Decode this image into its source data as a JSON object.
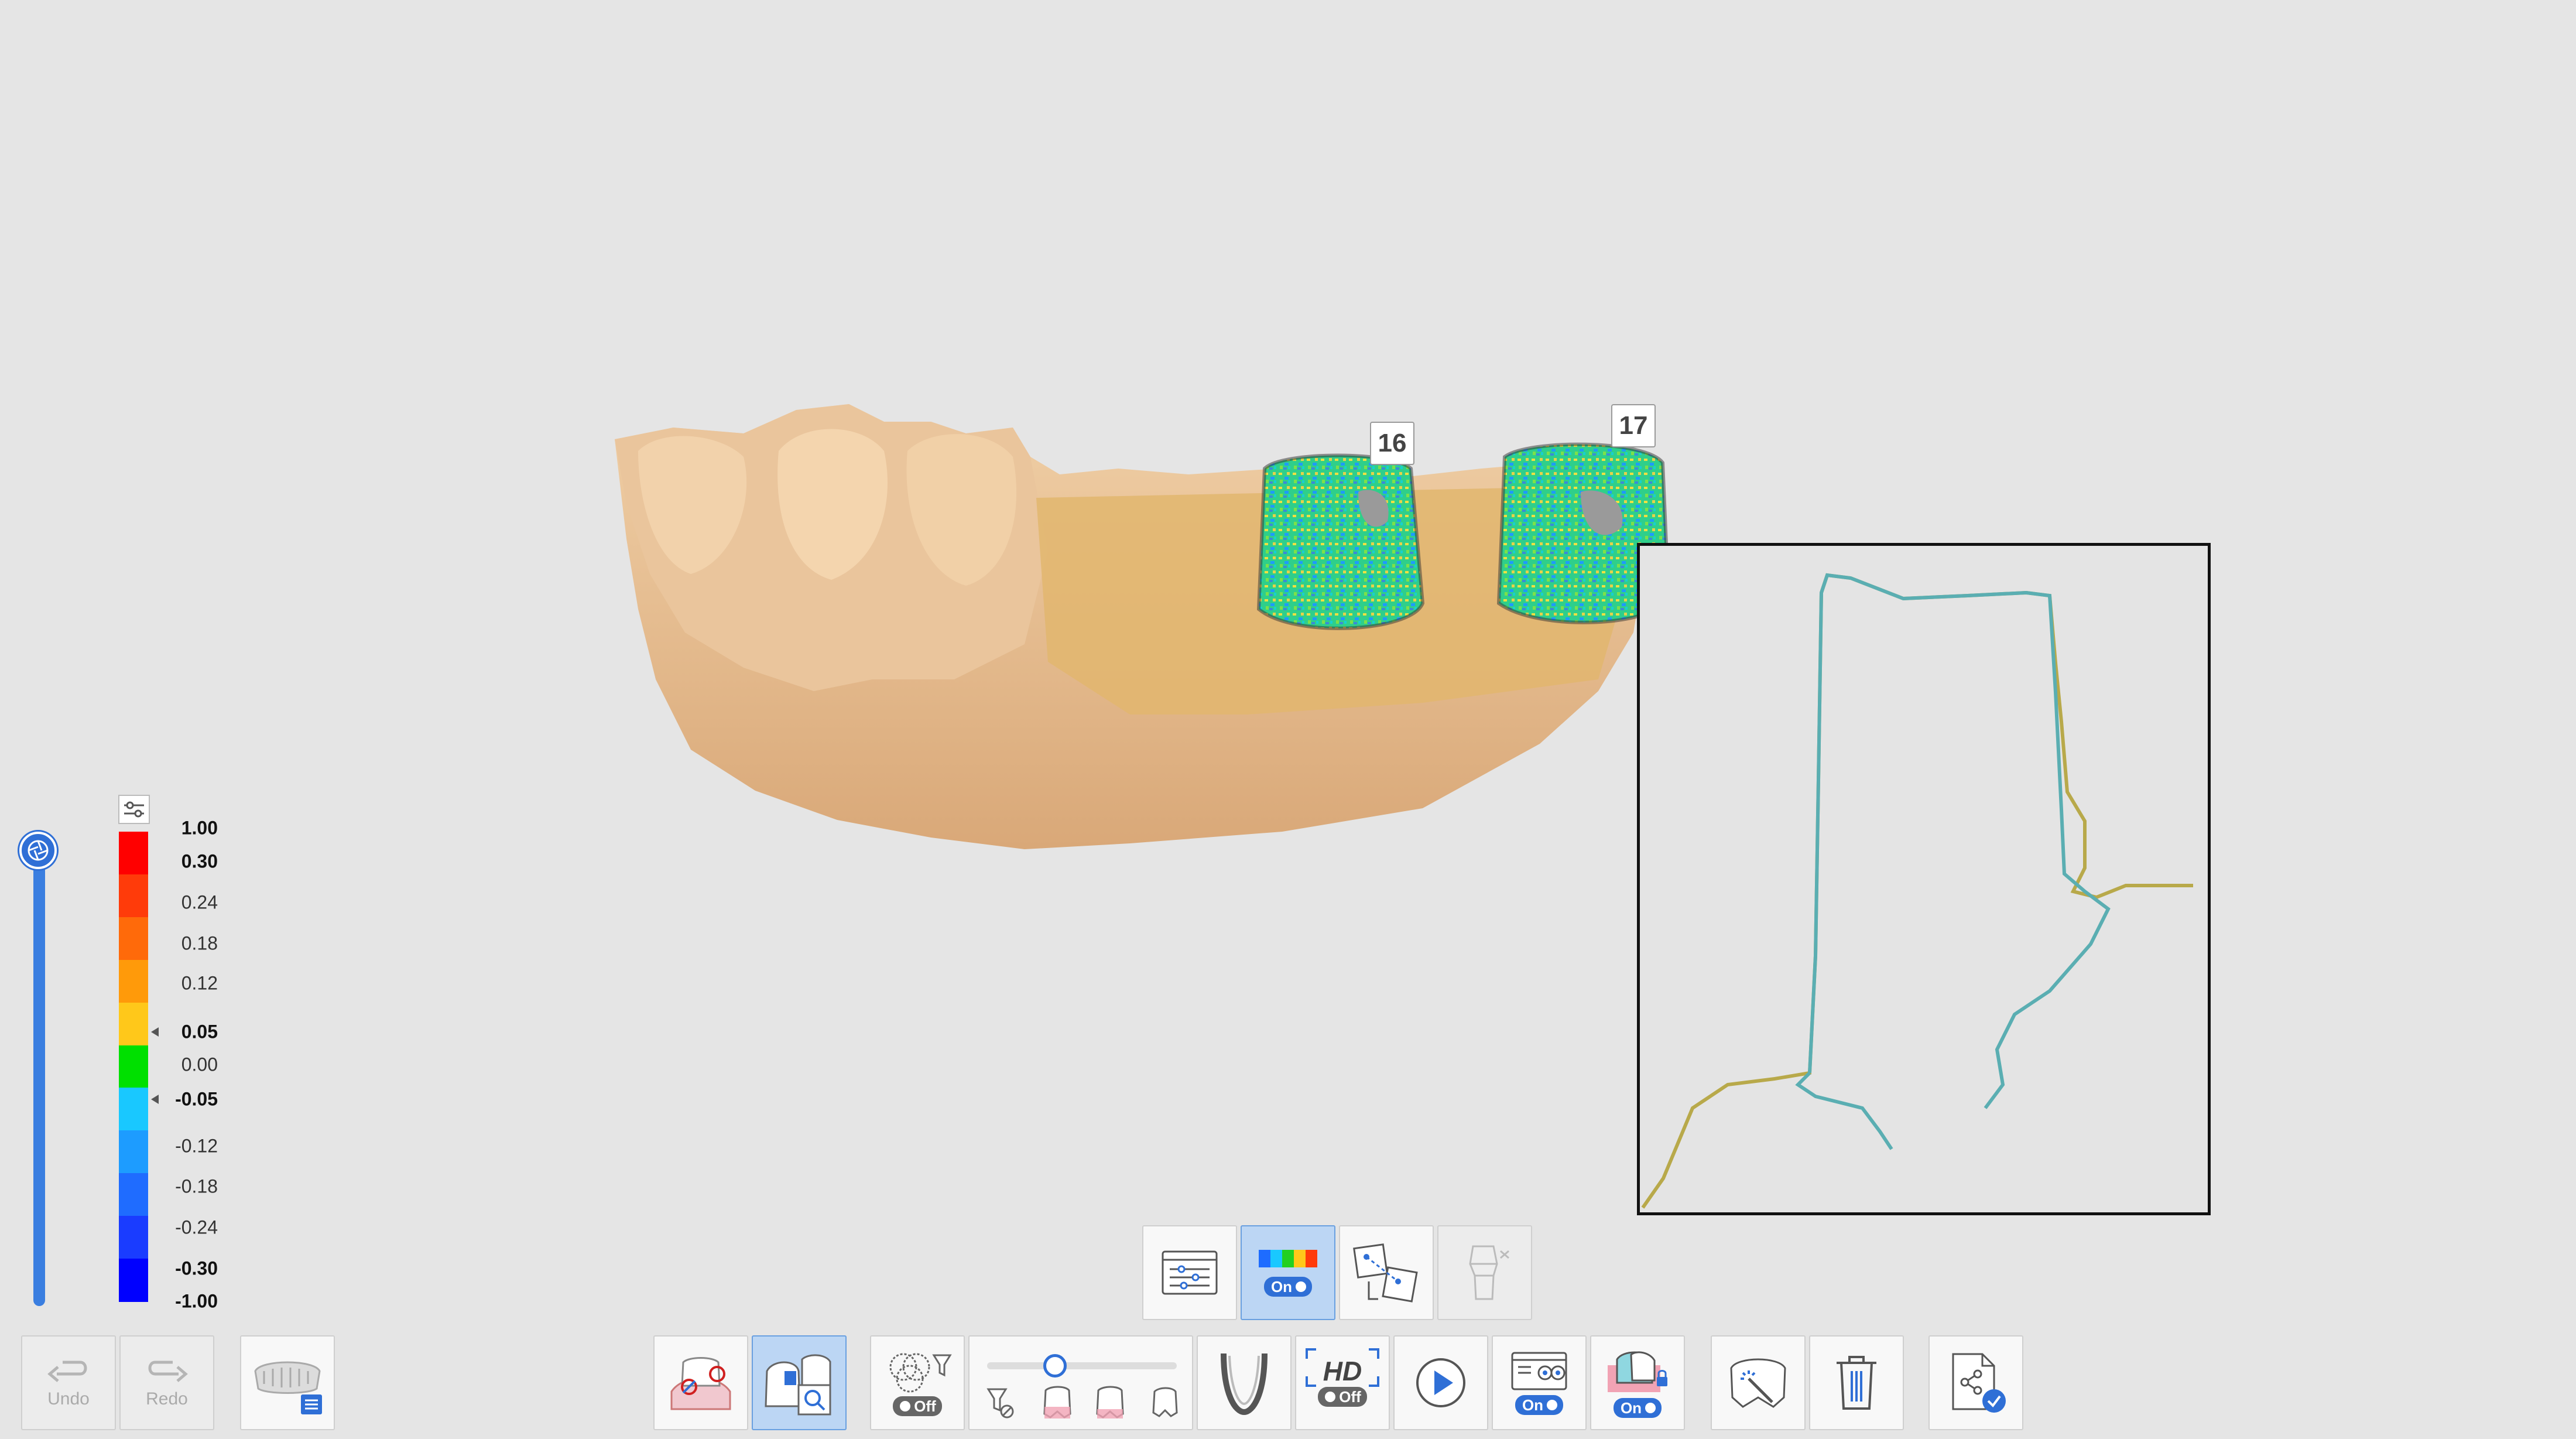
{
  "tooth_tags": [
    "16",
    "17"
  ],
  "color_scale": {
    "labels": [
      "1.00",
      "0.30",
      "0.24",
      "0.18",
      "0.12",
      "0.05",
      "0.00",
      "-0.05",
      "-0.12",
      "-0.18",
      "-0.24",
      "-0.30",
      "-1.00"
    ],
    "bold_labels": [
      "1.00",
      "0.30",
      "0.05",
      "-0.05",
      "-0.30",
      "-1.00"
    ],
    "marked_labels": [
      "0.05",
      "-0.05"
    ],
    "colors": [
      "#ff0000",
      "#ff3b0a",
      "#ff6a0a",
      "#ff9a0a",
      "#ffc81a",
      "#00e000",
      "#19c8ff",
      "#1d9cff",
      "#1f6cff",
      "#1a3cff",
      "#0000ff"
    ]
  },
  "history": {
    "undo_label": "Undo",
    "redo_label": "Redo"
  },
  "analysis_toolbar": {
    "deviation_toggle": "On"
  },
  "main_toolbar": {
    "filter_toggle": "Off",
    "hd_label": "HD",
    "hd_toggle": "Off",
    "view_toggle": "On",
    "lock_toggle": "On"
  },
  "colors": {
    "accent": "#2f6fd6",
    "active_button": "#bcd6f4",
    "model_tan": "#e8c197"
  }
}
